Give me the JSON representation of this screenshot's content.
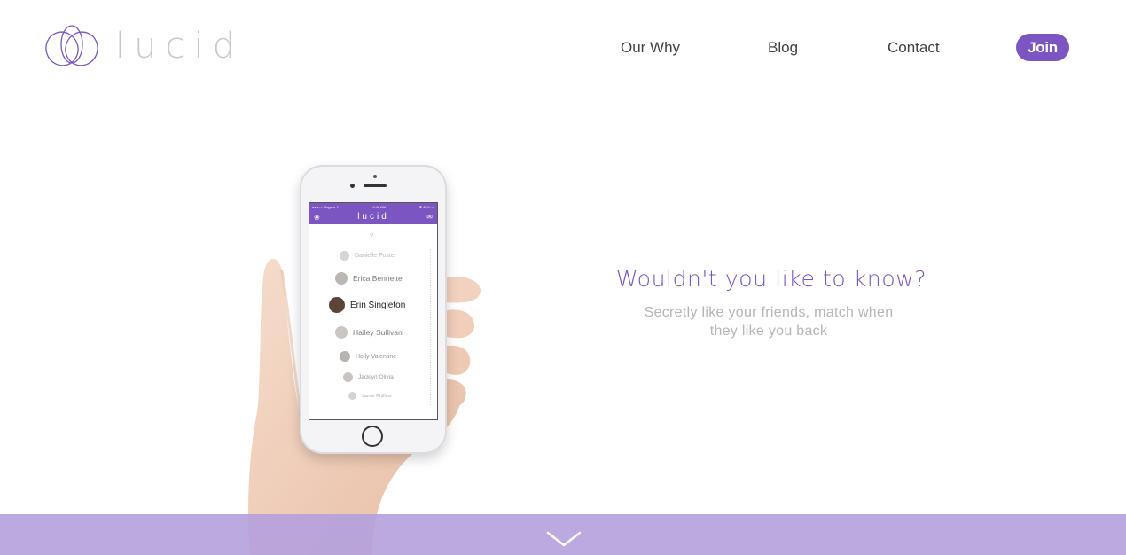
{
  "brand": {
    "name": "lucid",
    "logo_icon": "lotus-icon",
    "accent": "#7b55c2",
    "logo_text_color": "#c9c9cc"
  },
  "nav": {
    "links": [
      "Our Why",
      "Blog",
      "Contact"
    ],
    "join_label": "Join"
  },
  "hero": {
    "title": "Wouldn't you like to know?",
    "subtitle_line1": "Secretly like your friends, match when",
    "subtitle_line2": "they like you back"
  },
  "phone_app": {
    "status_left": "●●●○○ Rogers ✈",
    "status_time": "9:41 AM",
    "status_right": "✱ 42% ▭",
    "title": "lucid",
    "left_icon": "lotus-icon",
    "right_icon": "chat-icon",
    "search_icon": "search-icon",
    "contacts": [
      "Danielle Foster",
      "Erica Bennette",
      "Erin Singleton",
      "Hailey Sullivan",
      "Holly Valentine",
      "Jacklyn Olivia",
      "Jamie Phillips"
    ]
  },
  "footer": {
    "scroll_icon": "chevron-down-icon",
    "bar_color": "#b4a0dc"
  }
}
